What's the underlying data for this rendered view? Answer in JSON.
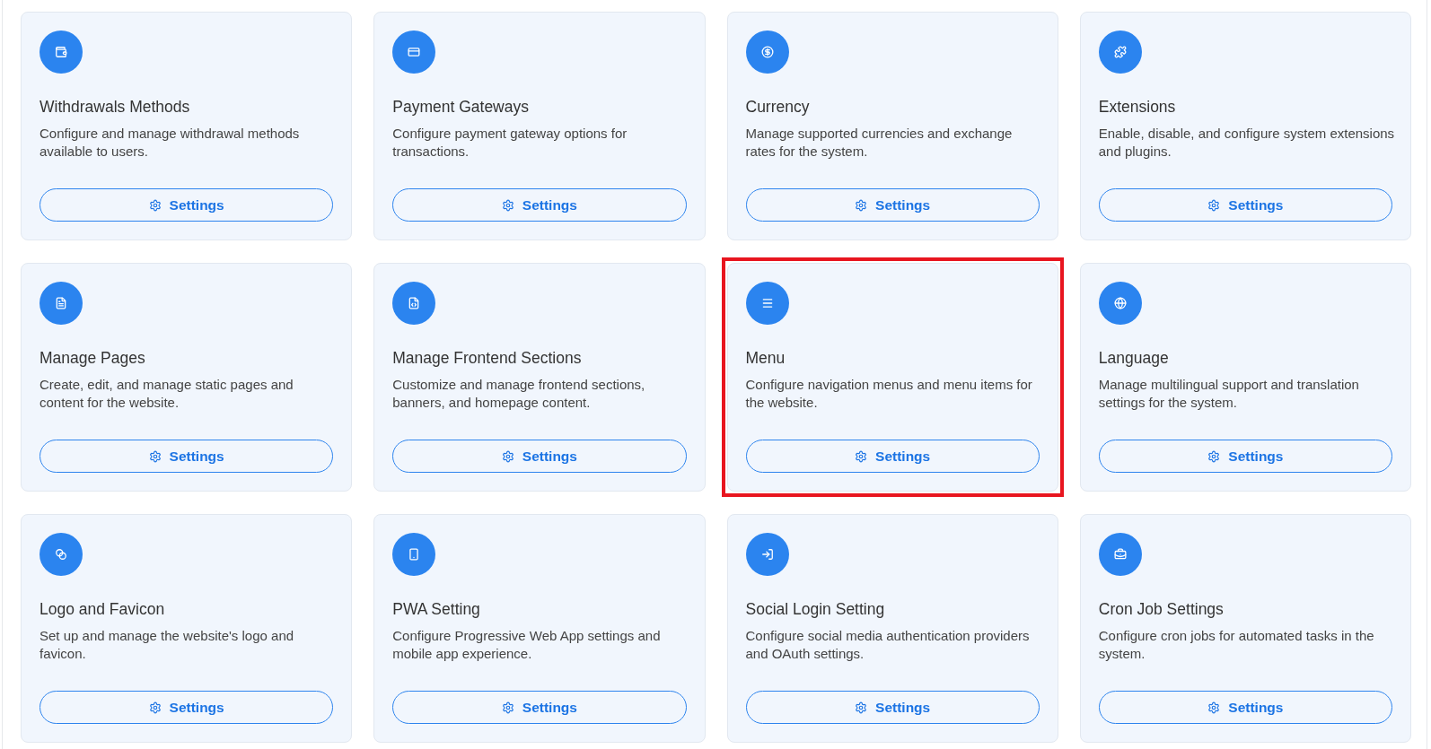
{
  "cards": [
    {
      "kind": "withdrawals",
      "title": "Withdrawals Methods",
      "description": "Configure and manage withdrawal methods available to users.",
      "button": "Settings",
      "highlighted": false
    },
    {
      "kind": "payments",
      "title": "Payment Gateways",
      "description": "Configure payment gateway options for transactions.",
      "button": "Settings",
      "highlighted": false
    },
    {
      "kind": "currency",
      "title": "Currency",
      "description": "Manage supported currencies and exchange rates for the system.",
      "button": "Settings",
      "highlighted": false
    },
    {
      "kind": "extensions",
      "title": "Extensions",
      "description": "Enable, disable, and configure system extensions and plugins.",
      "button": "Settings",
      "highlighted": false
    },
    {
      "kind": "pages",
      "title": "Manage Pages",
      "description": "Create, edit, and manage static pages and content for the website.",
      "button": "Settings",
      "highlighted": false
    },
    {
      "kind": "sections",
      "title": "Manage Frontend Sections",
      "description": "Customize and manage frontend sections, banners, and homepage content.",
      "button": "Settings",
      "highlighted": false
    },
    {
      "kind": "menu",
      "title": "Menu",
      "description": "Configure navigation menus and menu items for the website.",
      "button": "Settings",
      "highlighted": true
    },
    {
      "kind": "language",
      "title": "Language",
      "description": "Manage multilingual support and translation settings for the system.",
      "button": "Settings",
      "highlighted": false
    },
    {
      "kind": "branding",
      "title": "Logo and Favicon",
      "description": "Set up and manage the website's logo and favicon.",
      "button": "Settings",
      "highlighted": false
    },
    {
      "kind": "pwa",
      "title": "PWA Setting",
      "description": "Configure Progressive Web App settings and mobile app experience.",
      "button": "Settings",
      "highlighted": false
    },
    {
      "kind": "social",
      "title": "Social Login Setting",
      "description": "Configure social media authentication providers and OAuth settings.",
      "button": "Settings",
      "highlighted": false
    },
    {
      "kind": "cron",
      "title": "Cron Job Settings",
      "description": "Configure cron jobs for automated tasks in the system.",
      "button": "Settings",
      "highlighted": false
    }
  ]
}
